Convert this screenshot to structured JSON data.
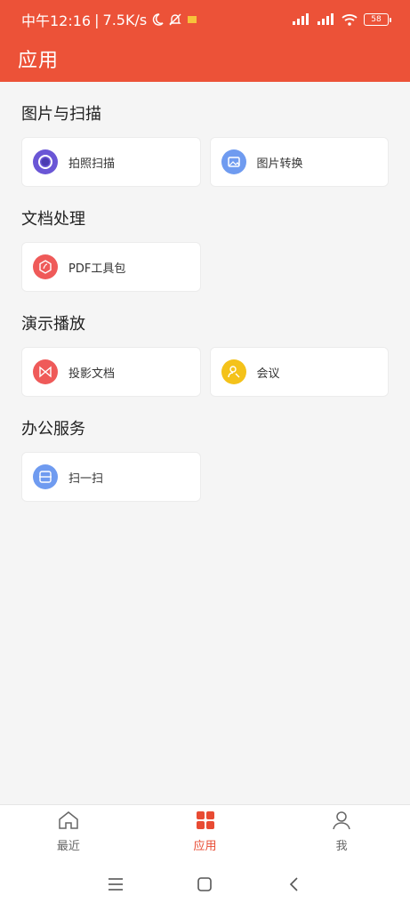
{
  "status": {
    "time": "中午12:16",
    "net_speed": "7.5K/s",
    "battery": "58"
  },
  "header": {
    "title": "应用"
  },
  "sections": [
    {
      "title": "图片与扫描",
      "items": [
        {
          "label": "拍照扫描",
          "icon": "camera-scan-icon",
          "color": "#6a56d6"
        },
        {
          "label": "图片转换",
          "icon": "image-convert-icon",
          "color": "#6f9bf0"
        }
      ]
    },
    {
      "title": "文档处理",
      "items": [
        {
          "label": "PDF工具包",
          "icon": "pdf-tools-icon",
          "color": "#ef5a59"
        }
      ]
    },
    {
      "title": "演示播放",
      "items": [
        {
          "label": "投影文档",
          "icon": "projection-icon",
          "color": "#ef5a59"
        },
        {
          "label": "会议",
          "icon": "meeting-icon",
          "color": "#f4c21a"
        }
      ]
    },
    {
      "title": "办公服务",
      "items": [
        {
          "label": "扫一扫",
          "icon": "scan-icon",
          "color": "#6f9bf0"
        }
      ]
    }
  ],
  "bottom_nav": {
    "recent": "最近",
    "apps": "应用",
    "me": "我"
  },
  "colors": {
    "brand": "#ec5238",
    "active_tab": "#e84b33"
  }
}
